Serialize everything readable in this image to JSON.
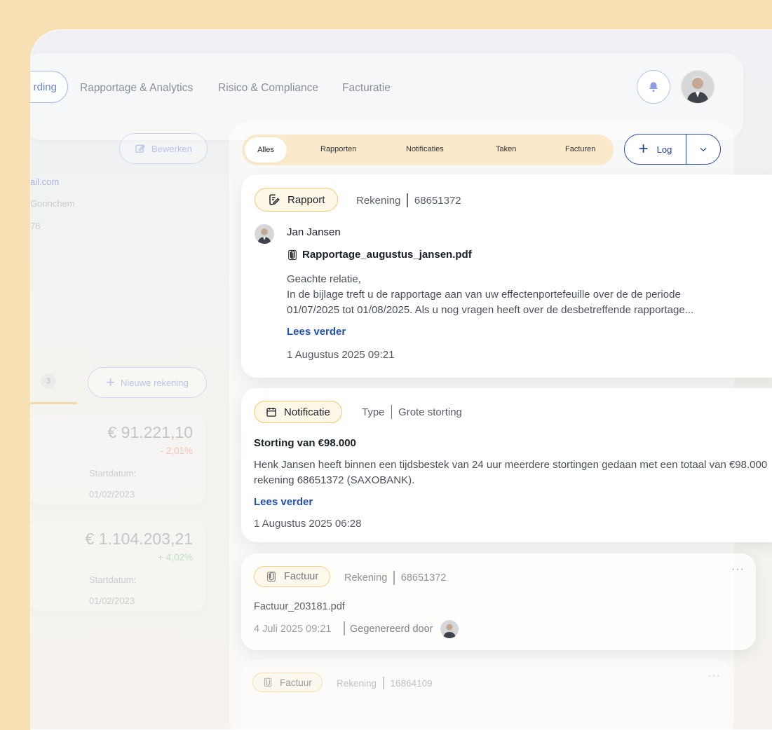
{
  "nav": {
    "active_tab_partial": "rding",
    "tabs": [
      "Rapportage & Analytics",
      "Risico & Compliance",
      "Facturatie"
    ],
    "icons": [
      "bell-icon",
      "avatar"
    ]
  },
  "left": {
    "edit_button": "Bewerken",
    "email_partial": "ail.com",
    "city_partial": "Gorinchem",
    "phone_partial": "78",
    "count_badge": "3",
    "new_account_button": "Nieuwe rekening",
    "accounts": [
      {
        "amount": "€ 91.221,10",
        "change": "- 2,01%",
        "start_label": "Startdatum:",
        "start_date": "01/02/2023",
        "change_color": "#ee9a8c"
      },
      {
        "amount": "€ 1.104.203,21",
        "change": "+ 4,02%",
        "start_label": "Startdatum:",
        "start_date": "01/02/2023",
        "change_color": "#8cd49d"
      }
    ]
  },
  "filters": {
    "active": "Alles",
    "tabs": [
      "Rapporten",
      "Notificaties",
      "Taken",
      "Facturen"
    ],
    "log_button": "Log"
  },
  "feed": {
    "rapport": {
      "tag": "Rapport",
      "meta_label": "Rekening",
      "meta_value": "68651372",
      "author": "Jan Jansen",
      "file": "Rapportage_augustus_jansen.pdf",
      "line1": "Geachte relatie,",
      "line2": "In de bijlage treft u de rapportage aan van uw effectenportefeuille over de de periode",
      "line3": "01/07/2025 tot 01/08/2025. Als u nog vragen heeft over de desbetreffende rapportage...",
      "read_more": "Lees verder",
      "date": "1 Augustus 2025 09:21"
    },
    "notificatie": {
      "tag": "Notificatie",
      "meta_label": "Type",
      "meta_value": "Grote storting",
      "title": "Storting van €98.000",
      "line1": "Henk Jansen heeft binnen een tijdsbestek van 24 uur meerdere stortingen gedaan met een totaal van €98.000",
      "line2": "rekening 68651372 (SAXOBANK).",
      "read_more": "Lees verder",
      "date": "1 Augustus 2025 06:28"
    },
    "factuur1": {
      "tag": "Factuur",
      "meta_label": "Rekening",
      "meta_value": "68651372",
      "file": "Factuur_203181.pdf",
      "date": "4 Juli 2025 09:21",
      "generated_by": "Gegenereerd door",
      "more": "···"
    },
    "factuur2": {
      "tag": "Factuur",
      "meta_label": "Rekening",
      "meta_value": "16864109",
      "more": "···"
    }
  },
  "colors": {
    "accent_blue": "#234190",
    "tag_border": "#f2c86e",
    "outer_bg": "#f8e0b5"
  }
}
